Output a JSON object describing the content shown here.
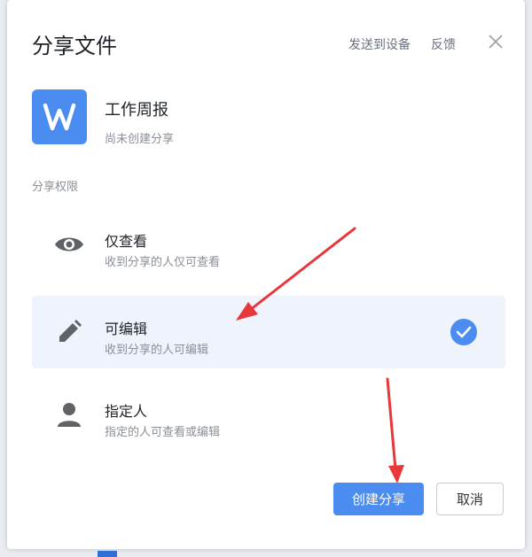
{
  "dialog": {
    "title": "分享文件",
    "send_to_device": "发送到设备",
    "feedback": "反馈"
  },
  "file": {
    "icon_letter": "W",
    "name": "工作周报",
    "status": "尚未创建分享"
  },
  "permissions": {
    "label": "分享权限",
    "options": [
      {
        "icon": "eye-icon",
        "title": "仅查看",
        "desc": "收到分享的人仅可查看",
        "selected": false
      },
      {
        "icon": "pencil-icon",
        "title": "可编辑",
        "desc": "收到分享的人可编辑",
        "selected": true
      },
      {
        "icon": "person-icon",
        "title": "指定人",
        "desc": "指定的人可查看或编辑",
        "selected": false
      }
    ]
  },
  "buttons": {
    "create": "创建分享",
    "cancel": "取消"
  },
  "colors": {
    "accent": "#4a8cf0",
    "selected_bg": "#eef3fc",
    "annotation_arrow": "#e8363a"
  }
}
